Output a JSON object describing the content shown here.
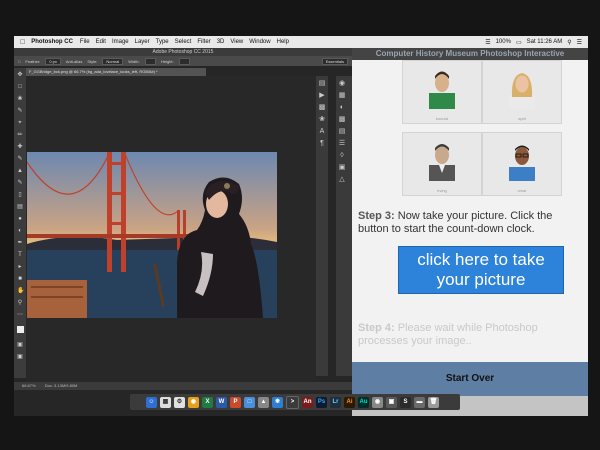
{
  "menubar": {
    "app_name": "Photoshop CC",
    "items": [
      "File",
      "Edit",
      "Image",
      "Layer",
      "Type",
      "Select",
      "Filter",
      "3D",
      "View",
      "Window",
      "Help"
    ],
    "battery": "100%",
    "clock": "Sat 11:26 AM"
  },
  "photoshop": {
    "window_title": "Adobe Photoshop CC 2015",
    "options": {
      "feather_label": "Feather:",
      "feather_value": "0 px",
      "antialias_label": "Anti-alias",
      "style_label": "Style:",
      "style_value": "Normal",
      "width_label": "Width:",
      "height_label": "Height:",
      "workspace": "Essentials"
    },
    "document_tab": "F_GGBridge_bck.png @ 66.7% (bg_ada_lovelace_looks_left, RGB/8#) *",
    "status_zoom": "66.67%",
    "status_doc": "Doc: 3.13M/9.80M"
  },
  "chm": {
    "title": "Computer History Museum Photoshop Interactive",
    "thumbs": [
      {
        "caption": "konrad"
      },
      {
        "caption": "april"
      },
      {
        "caption": "irving"
      },
      {
        "caption": "omar"
      }
    ],
    "step3_label": "Step 3:",
    "step3_text": "Now take your picture. Click the button to start the count-down clock.",
    "take_button": "click here to take your picture",
    "step4_label": "Step 4:",
    "step4_text": "Please wait while Photoshop processes your image..",
    "start_over": "Start Over"
  },
  "colors": {
    "take_button_bg": "#2d83d9",
    "start_over_bg": "#5f7ea3"
  }
}
